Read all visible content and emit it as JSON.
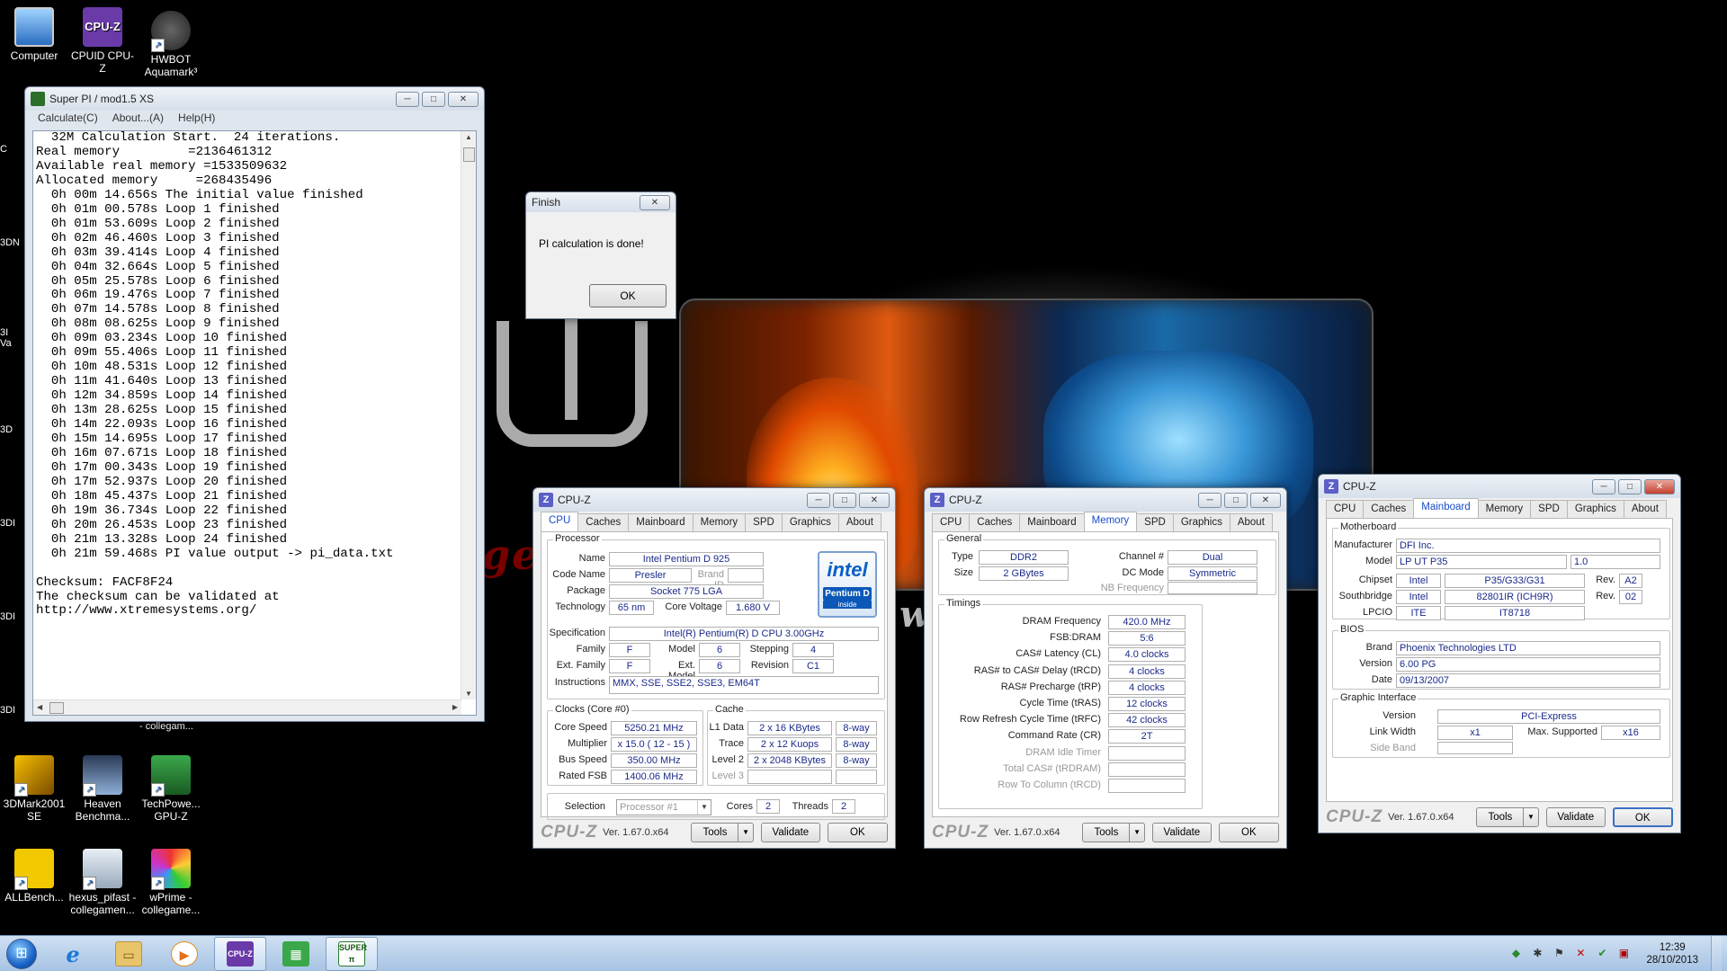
{
  "desktop": {
    "icons": [
      {
        "label": "Computer"
      },
      {
        "label": "CPUID CPU-Z"
      },
      {
        "label": "HWBOT Aquamark³"
      },
      {
        "label": "3DMark2001 SE"
      },
      {
        "label": "Heaven Benchma..."
      },
      {
        "label": "TechPowe... GPU-Z"
      },
      {
        "label": "ALLBench..."
      },
      {
        "label": "hexus_pifast - collegamen..."
      },
      {
        "label": "wPrime - collegame..."
      }
    ],
    "partial_labels": [
      "C",
      "3DN",
      "3I Va",
      "3D",
      "3DI",
      "3DI",
      "3DI",
      "- collegam..."
    ],
    "wallpaper_text": {
      "red": "ge",
      "silver": "w"
    },
    "colors": {
      "accent": "#1a4cc8",
      "value_text": "#1a2a8a"
    }
  },
  "superpi": {
    "title": "Super PI / mod1.5 XS",
    "menu": [
      "Calculate(C)",
      "About...(A)",
      "Help(H)"
    ],
    "output": "  32M Calculation Start.  24 iterations.\nReal memory         =2136461312\nAvailable real memory =1533509632\nAllocated memory     =268435496\n  0h 00m 14.656s The initial value finished\n  0h 01m 00.578s Loop 1 finished\n  0h 01m 53.609s Loop 2 finished\n  0h 02m 46.460s Loop 3 finished\n  0h 03m 39.414s Loop 4 finished\n  0h 04m 32.664s Loop 5 finished\n  0h 05m 25.578s Loop 6 finished\n  0h 06m 19.476s Loop 7 finished\n  0h 07m 14.578s Loop 8 finished\n  0h 08m 08.625s Loop 9 finished\n  0h 09m 03.234s Loop 10 finished\n  0h 09m 55.406s Loop 11 finished\n  0h 10m 48.531s Loop 12 finished\n  0h 11m 41.640s Loop 13 finished\n  0h 12m 34.859s Loop 14 finished\n  0h 13m 28.625s Loop 15 finished\n  0h 14m 22.093s Loop 16 finished\n  0h 15m 14.695s Loop 17 finished\n  0h 16m 07.671s Loop 18 finished\n  0h 17m 00.343s Loop 19 finished\n  0h 17m 52.937s Loop 20 finished\n  0h 18m 45.437s Loop 21 finished\n  0h 19m 36.734s Loop 22 finished\n  0h 20m 26.453s Loop 23 finished\n  0h 21m 13.328s Loop 24 finished\n  0h 21m 59.468s PI value output -> pi_data.txt\n\nChecksum: FACF8F24\nThe checksum can be validated at\nhttp://www.xtremesystems.org/"
  },
  "finish_dialog": {
    "title": "Finish",
    "message": "PI calculation is done!",
    "ok": "OK"
  },
  "cpuz_common": {
    "tabs": [
      "CPU",
      "Caches",
      "Mainboard",
      "Memory",
      "SPD",
      "Graphics",
      "About"
    ],
    "brand": "CPU-Z",
    "version": "Ver. 1.67.0.x64",
    "tools": "Tools",
    "validate": "Validate",
    "ok": "OK",
    "title": "CPU-Z"
  },
  "cpu": {
    "proc_legend": "Processor",
    "name_l": "Name",
    "name": "Intel Pentium D 925",
    "code_l": "Code Name",
    "code": "Presler",
    "brandid_l": "Brand ID",
    "package_l": "Package",
    "package": "Socket 775 LGA",
    "tech_l": "Technology",
    "tech": "65 nm",
    "volt_l": "Core Voltage",
    "volt": "1.680 V",
    "spec_l": "Specification",
    "spec": "Intel(R) Pentium(R) D CPU 3.00GHz",
    "family_l": "Family",
    "family": "F",
    "model_l": "Model",
    "model": "6",
    "step_l": "Stepping",
    "step": "4",
    "extfam_l": "Ext. Family",
    "extfam": "F",
    "extmod_l": "Ext. Model",
    "extmod": "6",
    "rev_l": "Revision",
    "rev": "C1",
    "instr_l": "Instructions",
    "instr": "MMX, SSE, SSE2, SSE3, EM64T",
    "logo": {
      "brand": "intel",
      "line": "Pentium D",
      "tag": "inside"
    },
    "clocks_legend": "Clocks (Core #0)",
    "speed_l": "Core Speed",
    "speed": "5250.21 MHz",
    "mult_l": "Multiplier",
    "mult": "x 15.0 ( 12 - 15 )",
    "bus_l": "Bus Speed",
    "bus": "350.00 MHz",
    "fsb_l": "Rated FSB",
    "fsb": "1400.06 MHz",
    "cache_legend": "Cache",
    "l1d_l": "L1 Data",
    "l1d": "2 x 16 KBytes",
    "l1d_w": "8-way",
    "trace_l": "Trace",
    "trace": "2 x 12 Kuops",
    "trace_w": "8-way",
    "l2_l": "Level 2",
    "l2": "2 x 2048 KBytes",
    "l2_w": "8-way",
    "l3_l": "Level 3",
    "sel_l": "Selection",
    "sel": "Processor #1",
    "cores_l": "Cores",
    "cores": "2",
    "threads_l": "Threads",
    "threads": "2"
  },
  "memory": {
    "gen_legend": "General",
    "type_l": "Type",
    "type": "DDR2",
    "chan_l": "Channel #",
    "chan": "Dual",
    "size_l": "Size",
    "size": "2 GBytes",
    "dc_l": "DC Mode",
    "dc": "Symmetric",
    "nb_l": "NB Frequency",
    "tim_legend": "Timings",
    "rows": [
      {
        "l": "DRAM Frequency",
        "v": "420.0 MHz",
        "dim": false
      },
      {
        "l": "FSB:DRAM",
        "v": "5:6",
        "dim": false
      },
      {
        "l": "CAS# Latency (CL)",
        "v": "4.0 clocks",
        "dim": false
      },
      {
        "l": "RAS# to CAS# Delay (tRCD)",
        "v": "4 clocks",
        "dim": false
      },
      {
        "l": "RAS# Precharge (tRP)",
        "v": "4 clocks",
        "dim": false
      },
      {
        "l": "Cycle Time (tRAS)",
        "v": "12 clocks",
        "dim": false
      },
      {
        "l": "Row Refresh Cycle Time (tRFC)",
        "v": "42 clocks",
        "dim": false
      },
      {
        "l": "Command Rate (CR)",
        "v": "2T",
        "dim": false
      },
      {
        "l": "DRAM Idle Timer",
        "v": "",
        "dim": true
      },
      {
        "l": "Total CAS# (tRDRAM)",
        "v": "",
        "dim": true
      },
      {
        "l": "Row To Column (tRCD)",
        "v": "",
        "dim": true
      }
    ]
  },
  "mainboard": {
    "mb_legend": "Motherboard",
    "manu_l": "Manufacturer",
    "manu": "DFI Inc.",
    "model_l": "Model",
    "model": "LP UT P35",
    "model_rev": "1.0",
    "chip_l": "Chipset",
    "chip_v": "Intel",
    "chip": "P35/G33/G31",
    "chip_rev_l": "Rev.",
    "chip_rev": "A2",
    "sb_l": "Southbridge",
    "sb_v": "Intel",
    "sb": "82801IR (ICH9R)",
    "sb_rev_l": "Rev.",
    "sb_rev": "02",
    "lpcio_l": "LPCIO",
    "lpcio_v": "ITE",
    "lpcio": "IT8718",
    "bios_legend": "BIOS",
    "bbrand_l": "Brand",
    "bbrand": "Phoenix Technologies LTD",
    "bver_l": "Version",
    "bver": "6.00 PG",
    "bdate_l": "Date",
    "bdate": "09/13/2007",
    "gi_legend": "Graphic Interface",
    "gver_l": "Version",
    "gver": "PCI-Express",
    "lw_l": "Link Width",
    "lw": "x1",
    "max_l": "Max. Supported",
    "max": "x16",
    "sideband_l": "Side Band"
  },
  "taskbar": {
    "items": [
      {
        "icon": "internet-explorer-icon",
        "glyph": "e"
      },
      {
        "icon": "folder-icon",
        "glyph": "▭"
      },
      {
        "icon": "media-player-icon",
        "glyph": "▶"
      },
      {
        "icon": "cpuz-taskbar-icon",
        "glyph": "CPU-Z"
      },
      {
        "icon": "gpu-z-taskbar-icon",
        "glyph": "▦"
      },
      {
        "icon": "superpi-taskbar-icon",
        "glyph": "SUPER π"
      }
    ],
    "time": "12:39",
    "date": "28/10/2013"
  }
}
